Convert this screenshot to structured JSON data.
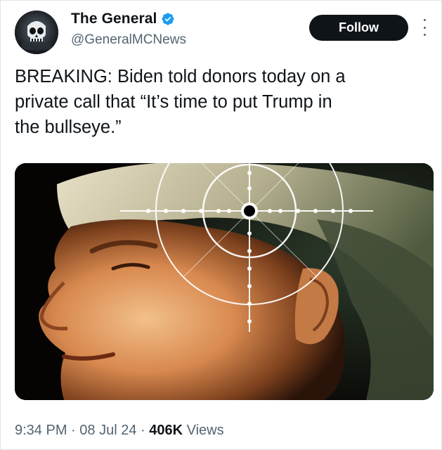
{
  "author": {
    "display_name": "The General",
    "handle": "@GeneralMCNews",
    "verified": true,
    "avatar_icon": "skull-avatar"
  },
  "follow_button": {
    "label": "Follow"
  },
  "more_button": {
    "icon": "more-options-icon"
  },
  "tweet": {
    "text_lines": [
      "BREAKING: Biden told donors today on a",
      "private call that “It’s time to put Trump in",
      "the bullseye.”"
    ]
  },
  "media": {
    "description_icon": "crosshair-overlay-icon"
  },
  "meta": {
    "time": "9:34 PM",
    "separator": "·",
    "date": "08 Jul 24",
    "views_count": "406K",
    "views_label": "Views"
  },
  "colors": {
    "accent": "#1d9bf0",
    "text": "#0f1419",
    "muted": "#536471",
    "button_bg": "#0f1419"
  }
}
